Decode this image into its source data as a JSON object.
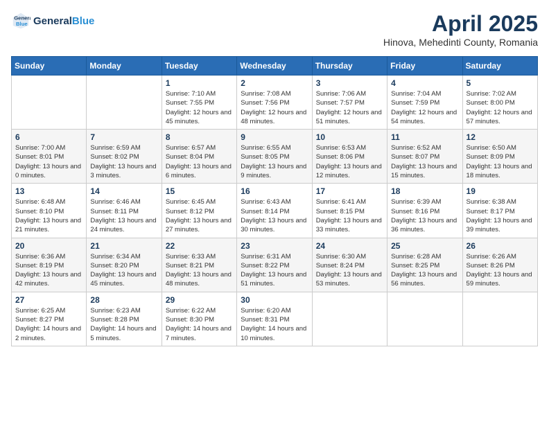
{
  "logo": {
    "line1": "General",
    "line2": "Blue"
  },
  "title": {
    "month_year": "April 2025",
    "location": "Hinova, Mehedinti County, Romania"
  },
  "weekdays": [
    "Sunday",
    "Monday",
    "Tuesday",
    "Wednesday",
    "Thursday",
    "Friday",
    "Saturday"
  ],
  "weeks": [
    [
      null,
      null,
      {
        "day": 1,
        "sunrise": "7:10 AM",
        "sunset": "7:55 PM",
        "daylight": "12 hours and 45 minutes."
      },
      {
        "day": 2,
        "sunrise": "7:08 AM",
        "sunset": "7:56 PM",
        "daylight": "12 hours and 48 minutes."
      },
      {
        "day": 3,
        "sunrise": "7:06 AM",
        "sunset": "7:57 PM",
        "daylight": "12 hours and 51 minutes."
      },
      {
        "day": 4,
        "sunrise": "7:04 AM",
        "sunset": "7:59 PM",
        "daylight": "12 hours and 54 minutes."
      },
      {
        "day": 5,
        "sunrise": "7:02 AM",
        "sunset": "8:00 PM",
        "daylight": "12 hours and 57 minutes."
      }
    ],
    [
      {
        "day": 6,
        "sunrise": "7:00 AM",
        "sunset": "8:01 PM",
        "daylight": "13 hours and 0 minutes."
      },
      {
        "day": 7,
        "sunrise": "6:59 AM",
        "sunset": "8:02 PM",
        "daylight": "13 hours and 3 minutes."
      },
      {
        "day": 8,
        "sunrise": "6:57 AM",
        "sunset": "8:04 PM",
        "daylight": "13 hours and 6 minutes."
      },
      {
        "day": 9,
        "sunrise": "6:55 AM",
        "sunset": "8:05 PM",
        "daylight": "13 hours and 9 minutes."
      },
      {
        "day": 10,
        "sunrise": "6:53 AM",
        "sunset": "8:06 PM",
        "daylight": "13 hours and 12 minutes."
      },
      {
        "day": 11,
        "sunrise": "6:52 AM",
        "sunset": "8:07 PM",
        "daylight": "13 hours and 15 minutes."
      },
      {
        "day": 12,
        "sunrise": "6:50 AM",
        "sunset": "8:09 PM",
        "daylight": "13 hours and 18 minutes."
      }
    ],
    [
      {
        "day": 13,
        "sunrise": "6:48 AM",
        "sunset": "8:10 PM",
        "daylight": "13 hours and 21 minutes."
      },
      {
        "day": 14,
        "sunrise": "6:46 AM",
        "sunset": "8:11 PM",
        "daylight": "13 hours and 24 minutes."
      },
      {
        "day": 15,
        "sunrise": "6:45 AM",
        "sunset": "8:12 PM",
        "daylight": "13 hours and 27 minutes."
      },
      {
        "day": 16,
        "sunrise": "6:43 AM",
        "sunset": "8:14 PM",
        "daylight": "13 hours and 30 minutes."
      },
      {
        "day": 17,
        "sunrise": "6:41 AM",
        "sunset": "8:15 PM",
        "daylight": "13 hours and 33 minutes."
      },
      {
        "day": 18,
        "sunrise": "6:39 AM",
        "sunset": "8:16 PM",
        "daylight": "13 hours and 36 minutes."
      },
      {
        "day": 19,
        "sunrise": "6:38 AM",
        "sunset": "8:17 PM",
        "daylight": "13 hours and 39 minutes."
      }
    ],
    [
      {
        "day": 20,
        "sunrise": "6:36 AM",
        "sunset": "8:19 PM",
        "daylight": "13 hours and 42 minutes."
      },
      {
        "day": 21,
        "sunrise": "6:34 AM",
        "sunset": "8:20 PM",
        "daylight": "13 hours and 45 minutes."
      },
      {
        "day": 22,
        "sunrise": "6:33 AM",
        "sunset": "8:21 PM",
        "daylight": "13 hours and 48 minutes."
      },
      {
        "day": 23,
        "sunrise": "6:31 AM",
        "sunset": "8:22 PM",
        "daylight": "13 hours and 51 minutes."
      },
      {
        "day": 24,
        "sunrise": "6:30 AM",
        "sunset": "8:24 PM",
        "daylight": "13 hours and 53 minutes."
      },
      {
        "day": 25,
        "sunrise": "6:28 AM",
        "sunset": "8:25 PM",
        "daylight": "13 hours and 56 minutes."
      },
      {
        "day": 26,
        "sunrise": "6:26 AM",
        "sunset": "8:26 PM",
        "daylight": "13 hours and 59 minutes."
      }
    ],
    [
      {
        "day": 27,
        "sunrise": "6:25 AM",
        "sunset": "8:27 PM",
        "daylight": "14 hours and 2 minutes."
      },
      {
        "day": 28,
        "sunrise": "6:23 AM",
        "sunset": "8:28 PM",
        "daylight": "14 hours and 5 minutes."
      },
      {
        "day": 29,
        "sunrise": "6:22 AM",
        "sunset": "8:30 PM",
        "daylight": "14 hours and 7 minutes."
      },
      {
        "day": 30,
        "sunrise": "6:20 AM",
        "sunset": "8:31 PM",
        "daylight": "14 hours and 10 minutes."
      },
      null,
      null,
      null
    ]
  ]
}
